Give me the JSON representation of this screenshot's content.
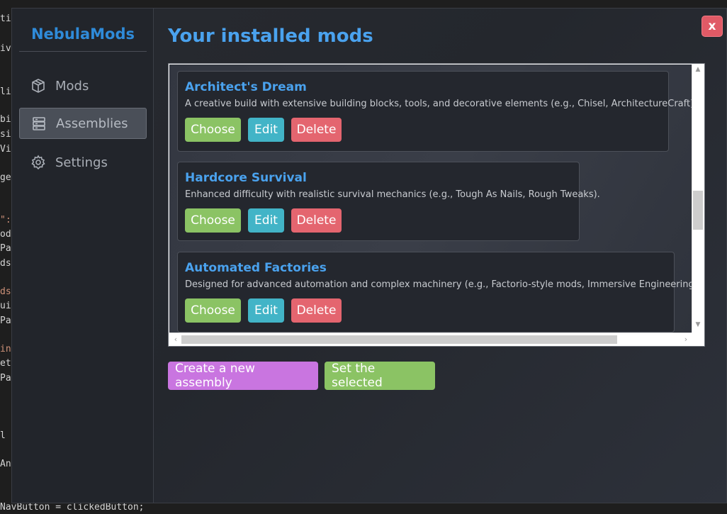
{
  "background_code": {
    "fragments": [
      "ti",
      "iv",
      "li",
      "bi",
      "si",
      "Vi",
      "ge",
      "\":",
      "od",
      "Pa",
      "ds",
      "ds",
      "ui",
      "Pa",
      "in",
      "et",
      "Pa",
      "l",
      "An"
    ],
    "bottom_line": "NavButton = clickedButton;"
  },
  "sidebar": {
    "brand": "NebulaMods",
    "items": [
      {
        "label": "Mods",
        "icon": "cube-icon"
      },
      {
        "label": "Assemblies",
        "icon": "stack-icon",
        "active": true
      },
      {
        "label": "Settings",
        "icon": "gear-icon"
      }
    ]
  },
  "main": {
    "title": "Your installed mods",
    "close_label": "x",
    "assemblies": [
      {
        "name": "Architect's Dream",
        "description": "A creative build with extensive building blocks, tools, and decorative elements (e.g., Chisel, ArchitectureCraft)."
      },
      {
        "name": "Hardcore Survival",
        "description": "Enhanced difficulty with realistic survival mechanics (e.g., Tough As Nails, Rough Tweaks)."
      },
      {
        "name": "Automated Factories",
        "description": "Designed for advanced automation and complex machinery (e.g., Factorio-style mods, Immersive Engineering)."
      }
    ],
    "card_buttons": {
      "choose": "Choose",
      "edit": "Edit",
      "delete": "Delete"
    },
    "actions": {
      "create": "Create a new assembly",
      "set": "Set the selected"
    }
  },
  "colors": {
    "accent": "#4aa2ee",
    "brand": "#2f8bd9",
    "choose": "#8bc364",
    "edit": "#42b4c7",
    "delete": "#e4656f",
    "create": "#c975e0",
    "close": "#e05a66"
  }
}
